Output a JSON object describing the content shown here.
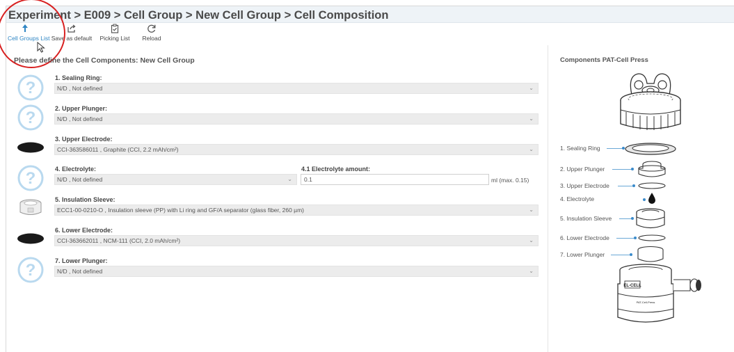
{
  "breadcrumb": "Experiment > E009 > Cell Group > New Cell Group > Cell Composition",
  "toolbar": {
    "cell_groups_list": "Cell Groups List",
    "save_as_default": "Save as default",
    "picking_list": "Picking List",
    "reload": "Reload"
  },
  "section_title": "Please define the Cell Components: New Cell Group",
  "components": [
    {
      "label": "1. Sealing Ring:",
      "value": "N/D , Not defined",
      "icon": "question-icon"
    },
    {
      "label": "2. Upper Plunger:",
      "value": "N/D , Not defined",
      "icon": "question-icon"
    },
    {
      "label": "3. Upper Electrode:",
      "value": "CCI-363586011 ,  Graphite (CCI, 2.2 mAh/cm²)",
      "icon": "electrode-disc-icon"
    },
    {
      "label": "4. Electrolyte:",
      "value": "N/D , Not defined",
      "icon": "question-icon"
    },
    {
      "label": "5. Insulation Sleeve:",
      "value": "ECC1-00-0210-O ,  Insulation sleeve (PP) with Li ring and GF/A separator (glass fiber, 260 µm)",
      "icon": "insulation-sleeve-icon"
    },
    {
      "label": "6. Lower Electrode:",
      "value": "CCI-363662011 ,  NCM-111 (CCI, 2.0 mAh/cm²)",
      "icon": "electrode-disc-icon"
    },
    {
      "label": "7. Lower Plunger:",
      "value": "N/D , Not defined",
      "icon": "question-icon"
    }
  ],
  "electrolyte_amount": {
    "label": "4.1 Electrolyte amount:",
    "value": "0.1",
    "unit": "ml (max. 0.15)"
  },
  "right_panel": {
    "title": "Components PAT-Cell Press",
    "parts": [
      "1. Sealing Ring",
      "2. Upper Plunger",
      "3. Upper Electrode",
      "4. Electrolyte",
      "5. Insulation Sleeve",
      "6. Lower Electrode",
      "7. Lower Plunger"
    ],
    "base_brand": "EL-CELL",
    "base_model": "PAT-Cell-Press"
  },
  "colors": {
    "accent": "#2f86c4",
    "highlight_circle": "#d82020",
    "question_icon": "#b9d9ef"
  }
}
